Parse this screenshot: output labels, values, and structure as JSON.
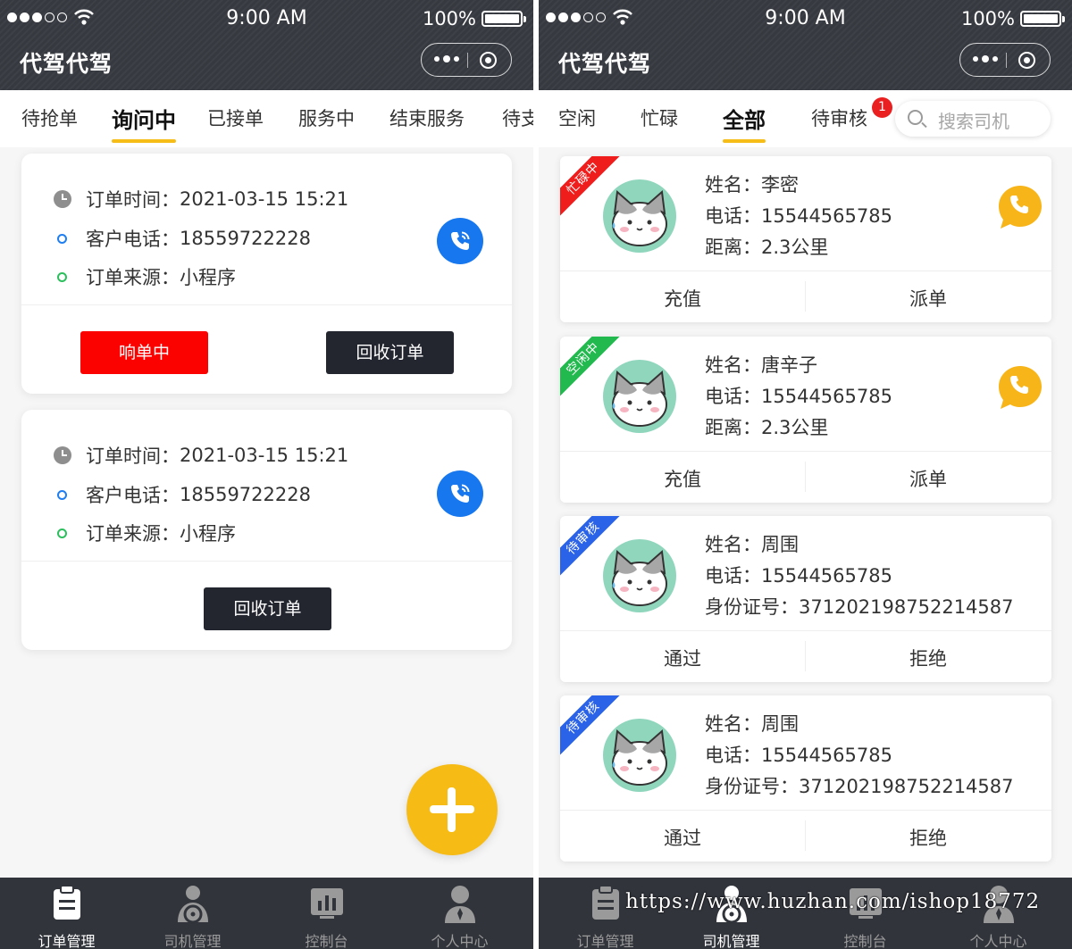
{
  "status_bar": {
    "time": "9:00 AM",
    "battery": "100%"
  },
  "left": {
    "app_title": "代驾代驾",
    "tabs": [
      {
        "label": "待抢单",
        "active": false
      },
      {
        "label": "询问中",
        "active": true
      },
      {
        "label": "已接单",
        "active": false
      },
      {
        "label": "服务中",
        "active": false
      },
      {
        "label": "结束服务",
        "active": false
      },
      {
        "label": "待支",
        "active": false
      }
    ],
    "orders": [
      {
        "time_label": "订单时间：",
        "time": "2021-03-15 15:21",
        "phone_label": "客户电话：",
        "phone": "18559722228",
        "source_label": "订单来源：",
        "source": "小程序",
        "buttons": [
          "响单中",
          "回收订单"
        ]
      },
      {
        "time_label": "订单时间：",
        "time": "2021-03-15 15:21",
        "phone_label": "客户电话：",
        "phone": "18559722228",
        "source_label": "订单来源：",
        "source": "小程序",
        "buttons": [
          "回收订单"
        ]
      }
    ],
    "nav": [
      {
        "label": "订单管理",
        "icon": "clipboard-icon",
        "active": true
      },
      {
        "label": "司机管理",
        "icon": "driver-icon",
        "active": false
      },
      {
        "label": "控制台",
        "icon": "chart-icon",
        "active": false
      },
      {
        "label": "个人中心",
        "icon": "person-icon",
        "active": false
      }
    ]
  },
  "right": {
    "app_title": "代驾代驾",
    "tabs": [
      {
        "label": "空闲",
        "active": false
      },
      {
        "label": "忙碌",
        "active": false
      },
      {
        "label": "全部",
        "active": true
      },
      {
        "label": "待审核",
        "active": false,
        "badge": "1"
      }
    ],
    "search_placeholder": "搜索司机",
    "drivers": [
      {
        "ribbon": "忙碌中",
        "ribbon_color": "#f01d1d",
        "name_label": "姓名：",
        "name": "李密",
        "phone_label": "电话：",
        "phone": "15544565785",
        "third_label": "距离：",
        "third": "2.3公里",
        "has_call": true,
        "actions": [
          "充值",
          "派单"
        ]
      },
      {
        "ribbon": "空闲中",
        "ribbon_color": "#22b94f",
        "name_label": "姓名：",
        "name": "唐辛子",
        "phone_label": "电话：",
        "phone": "15544565785",
        "third_label": "距离：",
        "third": "2.3公里",
        "has_call": true,
        "actions": [
          "充值",
          "派单"
        ]
      },
      {
        "ribbon": "待审核",
        "ribbon_color": "#2a63e8",
        "name_label": "姓名：",
        "name": "周围",
        "phone_label": "电话：",
        "phone": "15544565785",
        "third_label": "身份证号：",
        "third": "371202198752214587",
        "has_call": false,
        "actions": [
          "通过",
          "拒绝"
        ]
      },
      {
        "ribbon": "待审核",
        "ribbon_color": "#2a63e8",
        "name_label": "姓名：",
        "name": "周围",
        "phone_label": "电话：",
        "phone": "15544565785",
        "third_label": "身份证号：",
        "third": "371202198752214587",
        "has_call": false,
        "actions": [
          "通过",
          "拒绝"
        ]
      }
    ],
    "nav": [
      {
        "label": "订单管理",
        "icon": "clipboard-icon",
        "active": false
      },
      {
        "label": "司机管理",
        "icon": "driver-icon",
        "active": true
      },
      {
        "label": "控制台",
        "icon": "chart-icon",
        "active": false
      },
      {
        "label": "个人中心",
        "icon": "person-icon",
        "active": false
      }
    ]
  },
  "watermark": "https://www.huzhan.com/ishop18772",
  "colors": {
    "accent": "#f6bd19",
    "header": "#36393f",
    "nav": "#31343b",
    "call_blue": "#1677ee",
    "call_yellow": "#f7b51a"
  }
}
